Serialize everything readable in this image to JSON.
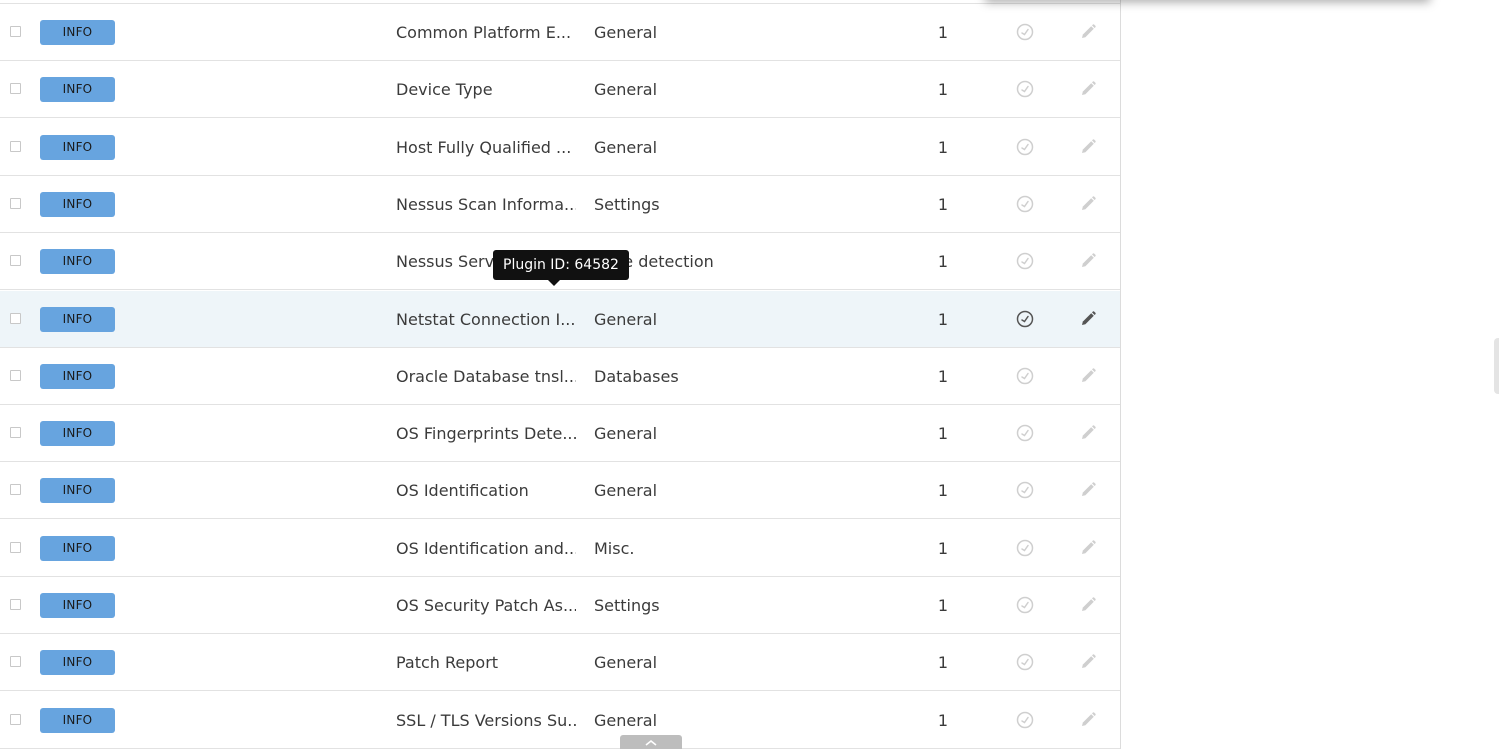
{
  "table": {
    "rows": [
      {
        "severity": "INFO",
        "name": "Common Platform E...",
        "family": "General",
        "count": "1"
      },
      {
        "severity": "INFO",
        "name": "Device Type",
        "family": "General",
        "count": "1"
      },
      {
        "severity": "INFO",
        "name": "Host Fully Qualified ...",
        "family": "General",
        "count": "1"
      },
      {
        "severity": "INFO",
        "name": "Nessus Scan Informa...",
        "family": "Settings",
        "count": "1"
      },
      {
        "severity": "INFO",
        "name": "Nessus Serve",
        "family": "rvice detection",
        "count": "1"
      },
      {
        "severity": "INFO",
        "name": "Netstat Connection I...",
        "family": "General",
        "count": "1"
      },
      {
        "severity": "INFO",
        "name": "Oracle Database tnsl...",
        "family": "Databases",
        "count": "1"
      },
      {
        "severity": "INFO",
        "name": "OS Fingerprints Dete...",
        "family": "General",
        "count": "1"
      },
      {
        "severity": "INFO",
        "name": "OS Identification",
        "family": "General",
        "count": "1"
      },
      {
        "severity": "INFO",
        "name": "OS Identification and...",
        "family": "Misc.",
        "count": "1"
      },
      {
        "severity": "INFO",
        "name": "OS Security Patch As...",
        "family": "Settings",
        "count": "1"
      },
      {
        "severity": "INFO",
        "name": "Patch Report",
        "family": "General",
        "count": "1"
      },
      {
        "severity": "INFO",
        "name": "SSL / TLS Versions Su...",
        "family": "General",
        "count": "1"
      }
    ],
    "hovered_row": 5
  },
  "tooltip": {
    "text": "Plugin ID: 64582"
  },
  "icons": {
    "row_snooze": "snooze-clock-icon",
    "row_edit": "pencil-edit-icon",
    "scroll_top": "chevron-up-icon"
  },
  "colors": {
    "severity_info": "#67a4df",
    "hover_row": "#eef5f9",
    "tooltip_bg": "#111111"
  }
}
